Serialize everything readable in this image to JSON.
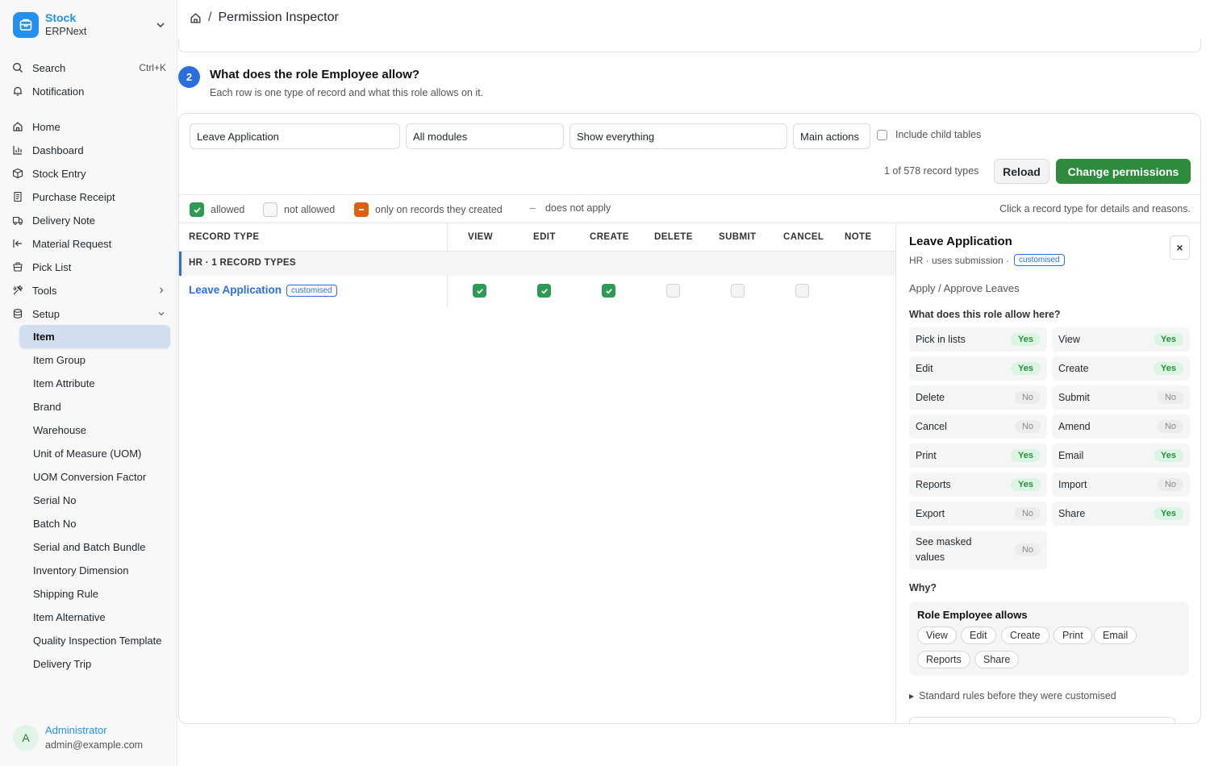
{
  "brand": {
    "name": "Stock",
    "sub": "ERPNext",
    "color": "#2490ef"
  },
  "sidebar": {
    "top": [
      {
        "label": "Search",
        "shortcut": "Ctrl+K",
        "icon": "search-icon"
      },
      {
        "label": "Notification",
        "icon": "bell-icon"
      }
    ],
    "nav": [
      {
        "label": "Home",
        "icon": "home-icon"
      },
      {
        "label": "Dashboard",
        "icon": "bar-chart-icon"
      },
      {
        "label": "Stock Entry",
        "icon": "box-icon"
      },
      {
        "label": "Purchase Receipt",
        "icon": "receipt-icon"
      },
      {
        "label": "Delivery Note",
        "icon": "truck-icon"
      },
      {
        "label": "Material Request",
        "icon": "arrow-left-bar-icon"
      },
      {
        "label": "Pick List",
        "icon": "list-icon"
      },
      {
        "label": "Tools",
        "icon": "tools-icon"
      },
      {
        "label": "Setup",
        "icon": "database-icon"
      }
    ],
    "setup_items": [
      "Item",
      "Item Group",
      "Item Attribute",
      "Brand",
      "Warehouse",
      "Unit of Measure (UOM)",
      "UOM Conversion Factor",
      "Serial No",
      "Batch No",
      "Serial and Batch Bundle",
      "Inventory Dimension",
      "Shipping Rule",
      "Item Alternative",
      "Quality Inspection Template",
      "Delivery Trip"
    ],
    "active_item": "Item",
    "user": {
      "initial": "A",
      "name": "Administrator",
      "email": "admin@example.com"
    }
  },
  "breadcrumb": {
    "page": "Permission Inspector"
  },
  "step": {
    "number": "2",
    "title": "What does the role Employee allow?",
    "subtitle": "Each row is one type of record and what this role allows on it."
  },
  "filters": {
    "doctype": "Leave Application",
    "module": "All modules",
    "show": "Show everything",
    "actions": "Main actions",
    "include_child": "Include child tables",
    "include_child_checked": false
  },
  "count_text": "1 of 578 record types",
  "buttons": {
    "reload": "Reload",
    "change": "Change permissions"
  },
  "legend": {
    "allowed": "allowed",
    "not_allowed": "not allowed",
    "own": "only on records they created",
    "na_symbol": "–",
    "na": "does not apply",
    "hint": "Click a record type for details and reasons."
  },
  "table": {
    "headers": [
      "RECORD TYPE",
      "VIEW",
      "EDIT",
      "CREATE",
      "DELETE",
      "SUBMIT",
      "CANCEL",
      "NOTE"
    ],
    "group": "HR · 1 RECORD TYPES",
    "rows": [
      {
        "name": "Leave Application",
        "tag": "customised",
        "perms": [
          true,
          true,
          true,
          false,
          false,
          false
        ]
      }
    ]
  },
  "detail": {
    "title": "Leave Application",
    "meta": "HR · uses submission ·",
    "tag": "customised",
    "description": "Apply / Approve Leaves",
    "question": "What does this role allow here?",
    "perms": [
      {
        "label": "Pick in lists",
        "value": "Yes"
      },
      {
        "label": "View",
        "value": "Yes"
      },
      {
        "label": "Edit",
        "value": "Yes"
      },
      {
        "label": "Create",
        "value": "Yes"
      },
      {
        "label": "Delete",
        "value": "No"
      },
      {
        "label": "Submit",
        "value": "No"
      },
      {
        "label": "Cancel",
        "value": "No"
      },
      {
        "label": "Amend",
        "value": "No"
      },
      {
        "label": "Print",
        "value": "Yes"
      },
      {
        "label": "Email",
        "value": "Yes"
      },
      {
        "label": "Reports",
        "value": "Yes"
      },
      {
        "label": "Import",
        "value": "No"
      },
      {
        "label": "Export",
        "value": "No"
      },
      {
        "label": "Share",
        "value": "Yes"
      },
      {
        "label": "See masked values",
        "value": "No"
      }
    ],
    "why": "Why?",
    "why_title": "Role Employee allows",
    "chips": [
      "View",
      "Edit",
      "Create",
      "Print",
      "Email",
      "Reports",
      "Share"
    ],
    "summary": "Standard rules before they were customised",
    "close": "×"
  }
}
